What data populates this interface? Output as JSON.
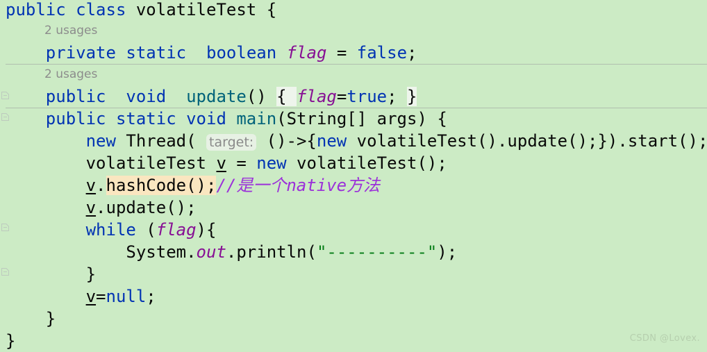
{
  "editor": {
    "background_color": "#CCEBC5",
    "language": "Java",
    "colors": {
      "keyword": "#0033B3",
      "static_field": "#871094",
      "method": "#00627A",
      "comment": "#9B30D9",
      "string": "#067D17",
      "default_text": "#080808",
      "inlay_hint": "#8c8c8c",
      "search_highlight": "#FAE6C0",
      "brace_highlight": "#EEF5EC",
      "separator": "#9a9a9a"
    }
  },
  "code": {
    "line_01": {
      "kw_public": "public",
      "sp1": " ",
      "kw_class": "class",
      "rest": " volatileTest {"
    },
    "usages_hint_1": "2 usages",
    "line_02": {
      "indent": "    ",
      "kw_private": "private",
      "sp1": " ",
      "kw_static": "static",
      "sp2": "  ",
      "kw_boolean": "boolean",
      "sp3": " ",
      "field_flag": "flag",
      "eq": " = ",
      "kw_false": "false",
      "semi": ";"
    },
    "usages_hint_2": "2 usages",
    "line_03": {
      "indent": "    ",
      "kw_public": "public",
      "sp1": "  ",
      "kw_void": "void",
      "sp2": "  ",
      "method_update": "update",
      "parens": "() ",
      "brace_open": "{",
      "sp3": " ",
      "field_flag": "flag",
      "eq": "=",
      "kw_true": "true",
      "semi": "; ",
      "brace_close": "}"
    },
    "line_04": {
      "indent": "    ",
      "kw_public": "public",
      "sp1": " ",
      "kw_static": "static",
      "sp2": " ",
      "kw_void": "void",
      "sp3": " ",
      "method_main": "main",
      "rest": "(String[] args) {"
    },
    "line_05": {
      "indent": "        ",
      "kw_new": "new",
      "thread": " Thread( ",
      "param_hint": "target:",
      "lambda": " ()->{",
      "kw_new2": "new",
      "tail": " volatileTest().update();}).start();"
    },
    "line_06": {
      "indent": "        ",
      "type": "volatileTest ",
      "local_v": "v",
      "eq": " = ",
      "kw_new": "new",
      "tail": " volatileTest();"
    },
    "line_07": {
      "indent": "        ",
      "local_v": "v",
      "dot": ".",
      "highlighted": "hashCode",
      "call": "();",
      "comment": "//是一个native方法"
    },
    "line_08": {
      "indent": "        ",
      "local_v": "v",
      "tail": ".update();"
    },
    "line_09": {
      "indent": "        ",
      "kw_while": "while",
      "paren_open": " (",
      "field_flag": "flag",
      "tail": "){"
    },
    "line_10": {
      "indent": "            ",
      "system": "System.",
      "field_out": "out",
      "println": ".println(",
      "string": "\"----------\"",
      "tail": ");"
    },
    "line_11": {
      "indent": "        ",
      "brace": "}"
    },
    "line_12": {
      "indent": "        ",
      "local_v": "v",
      "eq": "=",
      "kw_null": "null",
      "semi": ";"
    },
    "line_13": {
      "indent": "    ",
      "brace": "}"
    },
    "line_14": {
      "brace": "}"
    }
  },
  "watermark": {
    "text": "CSDN @Lovex."
  }
}
